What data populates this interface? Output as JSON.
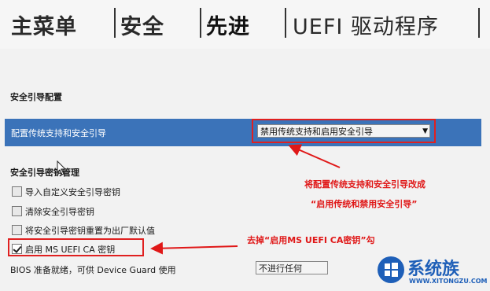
{
  "tabs": [
    {
      "label": "主菜单"
    },
    {
      "label": "安全"
    },
    {
      "label": "先进"
    },
    {
      "label": "UEFI 驱动程序"
    }
  ],
  "secure_boot": {
    "section_title": "安全引导配置",
    "config_label": "配置传统支持和安全引导",
    "config_value": "禁用传统支持和启用安全引导"
  },
  "key_mgmt": {
    "title": "安全引导密钥管理",
    "items": [
      {
        "label": "导入自定义安全引导密钥",
        "checked": false
      },
      {
        "label": "清除安全引导密钥",
        "checked": false
      },
      {
        "label": "将安全引导密钥重置为出厂默认值",
        "checked": false
      },
      {
        "label": "启用 MS UEFI CA 密钥",
        "checked": true
      }
    ]
  },
  "bios": {
    "label": "BIOS 准备就绪，可供 Device Guard 使用",
    "value": "不进行任何"
  },
  "annotations": {
    "line1": "将配置传统支持和安全引导改成",
    "line2": "“启用传统和禁用安全引导”",
    "line3": "去掉“启用MS UEFI CA密钥”勾"
  },
  "watermark": {
    "title": "系统族",
    "url": "WWW.XITONGZU.COM"
  },
  "colors": {
    "highlight": "#3b73b9",
    "annotation": "#e01818",
    "watermark": "#1e5fb8"
  }
}
